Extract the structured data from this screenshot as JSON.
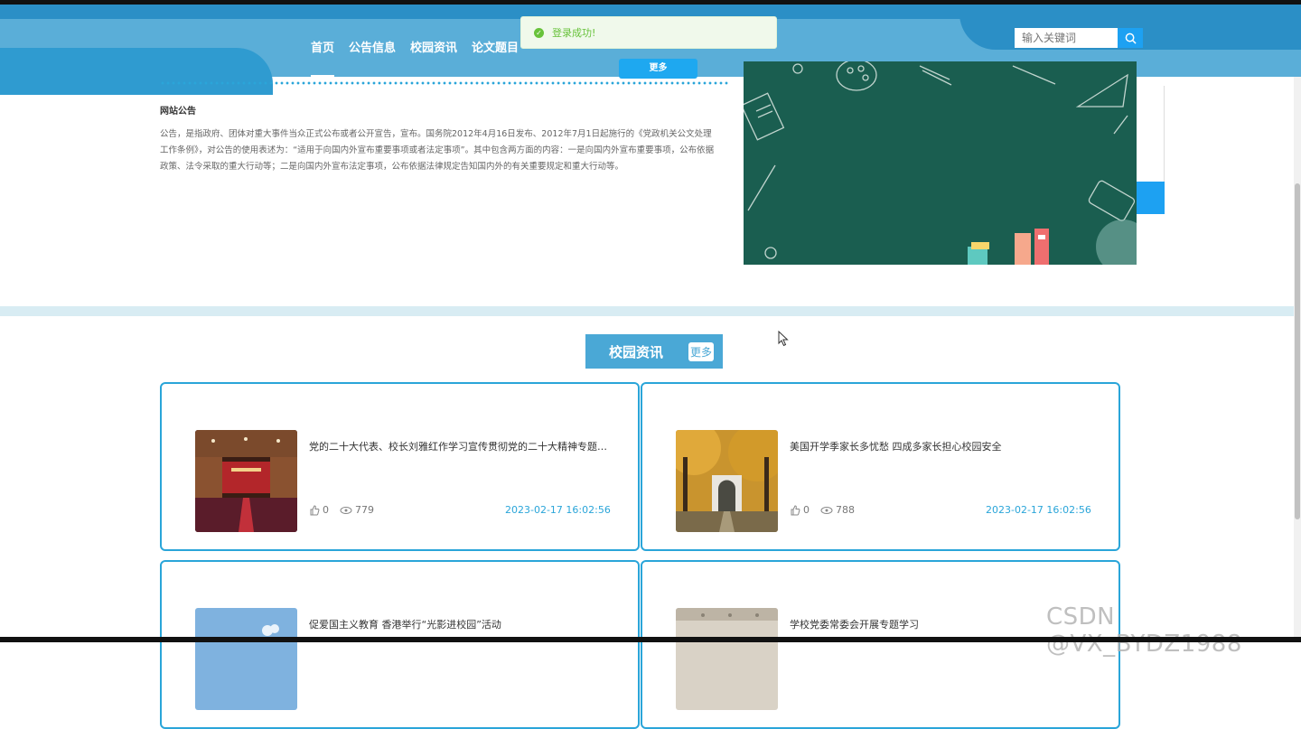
{
  "nav": {
    "items": [
      {
        "label": "首页"
      },
      {
        "label": "公告信息"
      },
      {
        "label": "校园资讯"
      },
      {
        "label": "论文题目"
      }
    ]
  },
  "search": {
    "placeholder": "输入关键词"
  },
  "toast": {
    "message": "登录成功!"
  },
  "notice": {
    "more_label": "更多",
    "title": "网站公告",
    "body": "公告，是指政府、团体对重大事件当众正式公布或者公开宣告，宣布。国务院2012年4月16日发布、2012年7月1日起施行的《党政机关公文处理工作条例》，对公告的使用表述为：“适用于向国内外宣布重要事项或者法定事项”。其中包含两方面的内容：一是向国内外宣布重要事项，公布依据政策、法令采取的重大行动等；二是向国内外宣布法定事项，公布依据法律规定告知国内外的有关重要规定和重大行动等。"
  },
  "news": {
    "title": "校园资讯",
    "more_label": "更多",
    "items": [
      {
        "title": "党的二十大代表、校长刘雅红作学习宣传贯彻党的二十大精神专题报告",
        "likes": "0",
        "views": "779",
        "date": "2023-02-17 16:02:56"
      },
      {
        "title": "美国开学季家长多忧愁 四成多家长担心校园安全",
        "likes": "0",
        "views": "788",
        "date": "2023-02-17 16:02:56"
      },
      {
        "title": "促爱国主义教育 香港举行“光影进校园”活动"
      },
      {
        "title": "学校党委常委会开展专题学习"
      }
    ]
  },
  "watermark": "CSDN @VX_BYDZ1988",
  "colors": {
    "primary": "#2aa5d9",
    "header": "#5aaed8",
    "success": "#67c23a"
  }
}
